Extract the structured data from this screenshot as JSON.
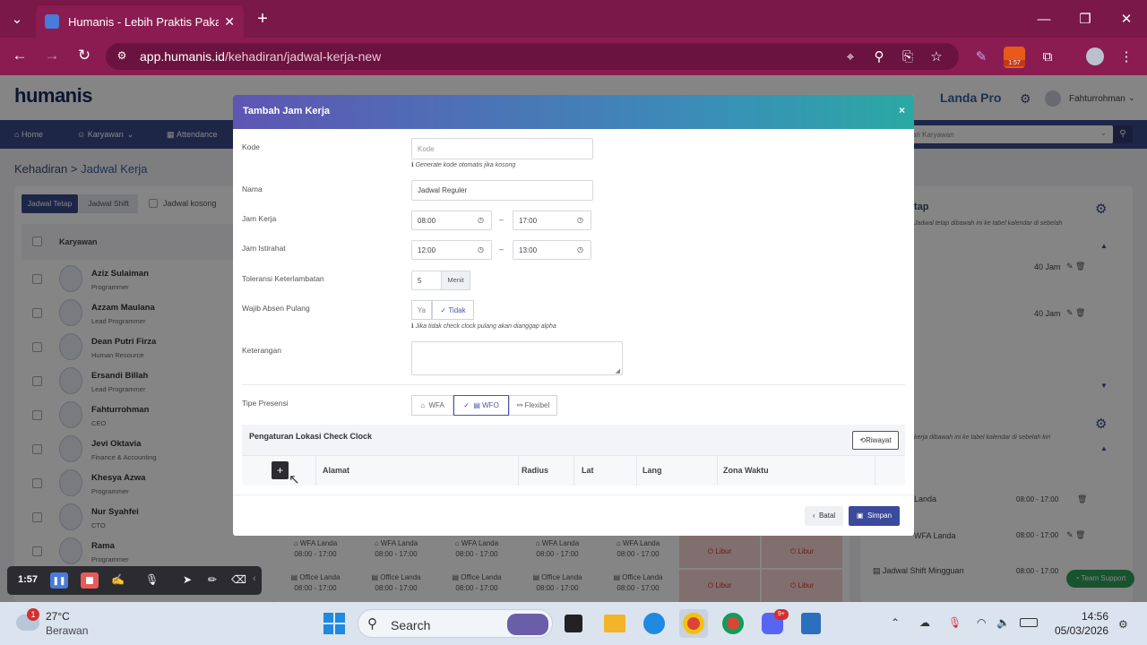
{
  "browser": {
    "tab_title": "Humanis - Lebih Praktis Pakai H",
    "url_host": "app.humanis.id",
    "url_path": "/kehadiran/jadwal-kerja-new",
    "ext_badge": "1:57"
  },
  "app": {
    "logo": "humanis",
    "company": "Landa Pro",
    "user": "Fahturrohman",
    "search_placeholder": "ari Karyawan",
    "nav": [
      "Home",
      "Karyawan",
      "Attendance"
    ],
    "breadcrumb_root": "Kehadiran",
    "breadcrumb_sep": " > ",
    "breadcrumb_current": "Jadwal Kerja"
  },
  "left_panel": {
    "tabs": [
      "Jadwal Tetap",
      "Jadwal Shift",
      "Jadwal kosong"
    ],
    "column_header": "Karyawan",
    "employees": [
      {
        "name": "Aziz Sulaiman",
        "role": "Programmer"
      },
      {
        "name": "Azzam Maulana",
        "role": "Lead Programmer"
      },
      {
        "name": "Dean Putri Firza",
        "role": "Human Resource"
      },
      {
        "name": "Ersandi Billah",
        "role": "Lead Programmer"
      },
      {
        "name": "Fahturrohman",
        "role": "CEO"
      },
      {
        "name": "Jevi Oktavia",
        "role": "Finance & Accounting"
      },
      {
        "name": "Khesya Azwa",
        "role": "Programmer"
      },
      {
        "name": "Nur Syahfei",
        "role": "CTO"
      },
      {
        "name": "Rama",
        "role": "Programmer"
      },
      {
        "name": "",
        "role": ""
      }
    ]
  },
  "schedule_rows": [
    {
      "cells": [
        "WFA Landa",
        "WFA Landa",
        "WFA Landa",
        "WFA Landa",
        "WFA Landa"
      ],
      "time": "08:00 - 17:00",
      "libur": "Libur"
    },
    {
      "cells": [
        "Office Landa",
        "Office Landa",
        "Office Landa",
        "Office Landa",
        "Office Landa"
      ],
      "time": "08:00 - 17:00",
      "libur": "Libur"
    }
  ],
  "right_panel": {
    "title_partial": "tap",
    "desc1": "Jadwal tetap dibawah ini ke tabel kalendar di sebelah",
    "hours": [
      "40 Jam",
      "40 Jam"
    ],
    "desc2": "kerja dibawah ini ke tabel kalendar di sebelah kiri",
    "items": [
      {
        "label": "Landa",
        "time": "08:00 - 17:00"
      },
      {
        "label": "WFA Landa",
        "time": "08:00 - 17:00"
      },
      {
        "label": "Jadwal Shift Mingguan",
        "time": "08:00 - 17:00"
      }
    ],
    "support": "Team Support"
  },
  "modal": {
    "title": "Tambah Jam Kerja",
    "close": "×",
    "fields": {
      "kode_label": "Kode",
      "kode_placeholder": "Kode",
      "kode_hint": "Generate kode otomatis jika kosong",
      "nama_label": "Nama",
      "nama_value": "Jadwal Reguler",
      "jam_kerja_label": "Jam Kerja",
      "jam_kerja_start": "08:00",
      "jam_kerja_end": "17:00",
      "jam_istirahat_label": "Jam Istirahat",
      "jam_istirahat_start": "12:00",
      "jam_istirahat_end": "13:00",
      "dash": "–",
      "toleransi_label": "Toleransi Keterlambatan",
      "toleransi_value": "5",
      "toleransi_unit": "Menit",
      "wajib_label": "Wajib Absen Pulang",
      "wajib_ya": "Ya",
      "wajib_tidak": "Tidak",
      "wajib_hint": "Jika tidak check clock pulang akan dianggap alpha",
      "keterangan_label": "Keterangan",
      "tipe_label": "Tipe Presensi",
      "tipe_options": [
        "WFA",
        "WFO",
        "Flexibel"
      ],
      "tipe_selected": "WFO"
    },
    "lokasi": {
      "title": "Pengaturan Lokasi Check Clock",
      "riwayat": "Riwayat",
      "add": "+",
      "columns": [
        "Alamat",
        "Radius",
        "Lat",
        "Lang",
        "Zona Waktu"
      ]
    },
    "footer": {
      "batal": "Batal",
      "simpan": "Simpan"
    }
  },
  "recorder": {
    "time": "1:57"
  },
  "taskbar": {
    "weather_temp": "27°C",
    "weather_desc": "Berawan",
    "weather_badge": "1",
    "search": "Search",
    "discord_badge": "9+",
    "time": "14:56",
    "date": "05/03/2026"
  }
}
